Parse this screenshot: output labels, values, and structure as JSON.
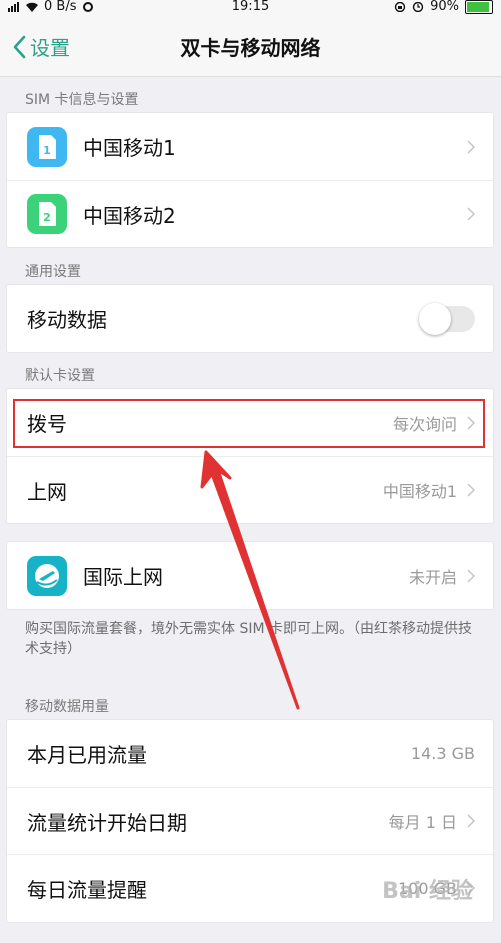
{
  "status_bar": {
    "speed": "0 B/s",
    "time": "19:15",
    "battery_percent": "90%",
    "battery_level": 0.9,
    "battery_color": "#3ec13e"
  },
  "nav": {
    "back_label": "设置",
    "title": "双卡与移动网络"
  },
  "sim_section": {
    "header": "SIM 卡信息与设置",
    "items": [
      {
        "label": "中国移动1",
        "badge": "1",
        "icon_color": "#3fb8f2",
        "icon": "sim-card-icon"
      },
      {
        "label": "中国移动2",
        "badge": "2",
        "icon_color": "#3cd27a",
        "icon": "sim-card-icon"
      }
    ]
  },
  "general_section": {
    "header": "通用设置",
    "mobile_data_label": "移动数据",
    "mobile_data_on": false
  },
  "default_section": {
    "header": "默认卡设置",
    "dial_label": "拨号",
    "dial_value": "每次询问",
    "internet_label": "上网",
    "internet_value": "中国移动1"
  },
  "roaming": {
    "label": "国际上网",
    "value": "未开启",
    "icon_color": "#16b3c6",
    "icon": "globe-plane-icon",
    "description": "购买国际流量套餐，境外无需实体 SIM 卡即可上网。（由红茶移动提供技术支持）"
  },
  "usage_section": {
    "header": "移动数据用量",
    "used_label": "本月已用流量",
    "used_value": "14.3 GB",
    "start_date_label": "流量统计开始日期",
    "start_date_value": "每月 1 日",
    "daily_reminder_label": "每日流量提醒",
    "daily_reminder_value": "100 GB"
  },
  "watermark": "Bai 经验",
  "annotation_color": "#e03232"
}
